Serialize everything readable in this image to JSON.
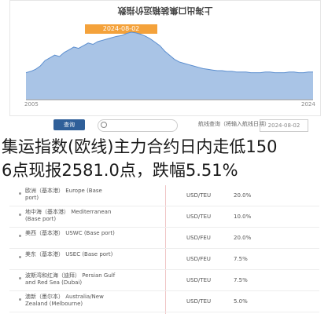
{
  "chart_panel": {
    "title": "上海出口集装箱运价指数",
    "date_box": "2024-08-02",
    "x_tick_left": "2005",
    "x_tick_right": "2024"
  },
  "chart_data": {
    "type": "area",
    "x": [
      0,
      1,
      2,
      3,
      4,
      5,
      6,
      7,
      8,
      9,
      10,
      11,
      12,
      13,
      14,
      15,
      16,
      17,
      18,
      19,
      20,
      21,
      22,
      23,
      24,
      25,
      26,
      27,
      28,
      29,
      30,
      31,
      32,
      33,
      34,
      35,
      36,
      37,
      38,
      39,
      40,
      41,
      42,
      43,
      44,
      45,
      46,
      47,
      48,
      49,
      50,
      51,
      52,
      53,
      54,
      55,
      56,
      57,
      58,
      59,
      60
    ],
    "values": [
      40,
      42,
      45,
      50,
      58,
      62,
      66,
      64,
      70,
      74,
      78,
      76,
      80,
      84,
      82,
      86,
      88,
      90,
      92,
      94,
      95,
      98,
      100,
      99,
      97,
      94,
      90,
      85,
      80,
      72,
      66,
      60,
      56,
      54,
      52,
      50,
      48,
      46,
      45,
      44,
      43,
      43,
      42,
      42,
      41,
      41,
      41,
      40,
      40,
      40,
      41,
      41,
      40,
      40,
      40,
      41,
      41,
      40,
      40,
      41,
      41
    ],
    "color": "#a9c4e6"
  },
  "search": {
    "button_label": "查询",
    "placeholder": "",
    "query_label": "航线查询（将输入航线日期）",
    "date_value": "2024-08-02"
  },
  "headline": {
    "line1": "集运指数(欧线)主力合约日内走低150",
    "line2": "6点现报2581.0点，跌幅5.51%"
  },
  "table": {
    "rows": [
      {
        "route": "欧洲（基本港）",
        "sub": "Europe (Base port)",
        "unit": "USD/TEU",
        "weight": "20.0%"
      },
      {
        "route": "地中海（基本港）",
        "sub": "Mediterranean (Base port)",
        "unit": "USD/TEU",
        "weight": "10.0%"
      },
      {
        "route": "美西（基本港）",
        "sub": "USWC (Base port)",
        "unit": "USD/FEU",
        "weight": "20.0%"
      },
      {
        "route": "美东（基本港）",
        "sub": "USEC (Base port)",
        "unit": "USD/FEU",
        "weight": "7.5%"
      },
      {
        "route": "波斯湾和红海（迪拜）",
        "sub": "Persian Gulf and Red Sea (Dubai)",
        "unit": "USD/TEU",
        "weight": "7.5%"
      },
      {
        "route": "澳新（墨尔本）",
        "sub": "Australia/New Zealand (Melbourne)",
        "unit": "USD/TEU",
        "weight": "5.0%"
      }
    ]
  },
  "colors": {
    "accent": "#2f5f99",
    "orange": "#f4a23b"
  }
}
